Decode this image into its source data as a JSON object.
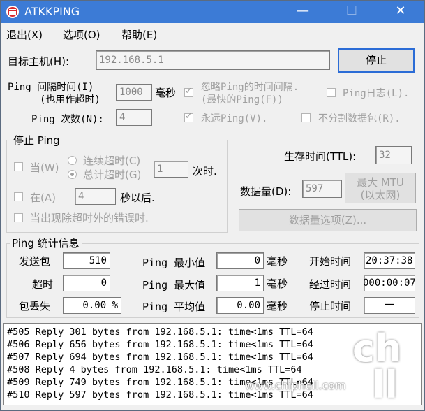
{
  "window": {
    "title": "ATKKPING",
    "minimize": "—",
    "maximize": "☐",
    "close": "✕",
    "accent": "#3c7bd6"
  },
  "menu": [
    "退出(X)",
    "选项(O)",
    "帮助(E)"
  ],
  "target": {
    "label": "目标主机(H):",
    "value": "192.168.5.1"
  },
  "stop_button": "停止",
  "interval": {
    "label1": "Ping 间隔时间(I)",
    "label2": "(也用作超时)",
    "value": "1000",
    "unit": "毫秒"
  },
  "count": {
    "label": "Ping 次数(N):",
    "value": "4"
  },
  "ignore_interval": {
    "label1": "忽略Ping的时间间隔.",
    "label2": "(最快的Ping(F))",
    "checked": true
  },
  "ping_log": {
    "label": "Ping日志(L).",
    "checked": false
  },
  "forever": {
    "label": "永远Ping(V).",
    "checked": true
  },
  "no_fragment": {
    "label": "不分割数据包(R).",
    "checked": false
  },
  "stop_group": {
    "title": "停止 Ping",
    "when_label": "当(W)",
    "consecutive_label": "连续超时(C)",
    "total_label": "总计超时(G)",
    "timeout_value": "1",
    "times_unit": "次时.",
    "at_label": "在(A)",
    "seconds_value": "4",
    "seconds_unit": "秒以后.",
    "error_label": "当出现除超时外的错误时."
  },
  "ttl": {
    "label": "生存时间(TTL):",
    "value": "32"
  },
  "data_size": {
    "label": "数据量(D):",
    "value": "597",
    "max_mtu_line1": "最大 MTU",
    "max_mtu_line2": "(以太网)"
  },
  "data_options_button": "数据量选项(Z)...",
  "stats": {
    "title": "Ping 统计信息",
    "sent_label": "发送包",
    "sent_value": "510",
    "timeout_label": "超时",
    "timeout_value": "0",
    "loss_label": "包丢失",
    "loss_value": "0.00",
    "loss_unit": "%",
    "min_label": "Ping 最小值",
    "min_value": "0",
    "max_label": "Ping 最大值",
    "max_value": "1",
    "avg_label": "Ping 平均值",
    "avg_value": "0.00",
    "ms_unit": "毫秒",
    "start_label": "开始时间",
    "start_value": "20:37:38",
    "elapsed_label": "经过时间",
    "elapsed_value": "000:00:07",
    "stop_label": "停止时间",
    "stop_value": "一"
  },
  "log_lines": [
    "#505 Reply 301 bytes from 192.168.5.1: time<1ms TTL=64",
    "#506 Reply 656 bytes from 192.168.5.1: time<1ms TTL=64",
    "#507 Reply 694 bytes from 192.168.5.1: time<1ms TTL=64",
    "#508 Reply 4 bytes from 192.168.5.1: time<1ms TTL=64",
    "#509 Reply 749 bytes from 192.168.5.1: time<1ms TTL=64",
    "#510 Reply 597 bytes from 192.168.5.1: time<1ms TTL=64"
  ],
  "watermark": {
    "logo": "chip hell",
    "url": "www.chiphell.com"
  }
}
